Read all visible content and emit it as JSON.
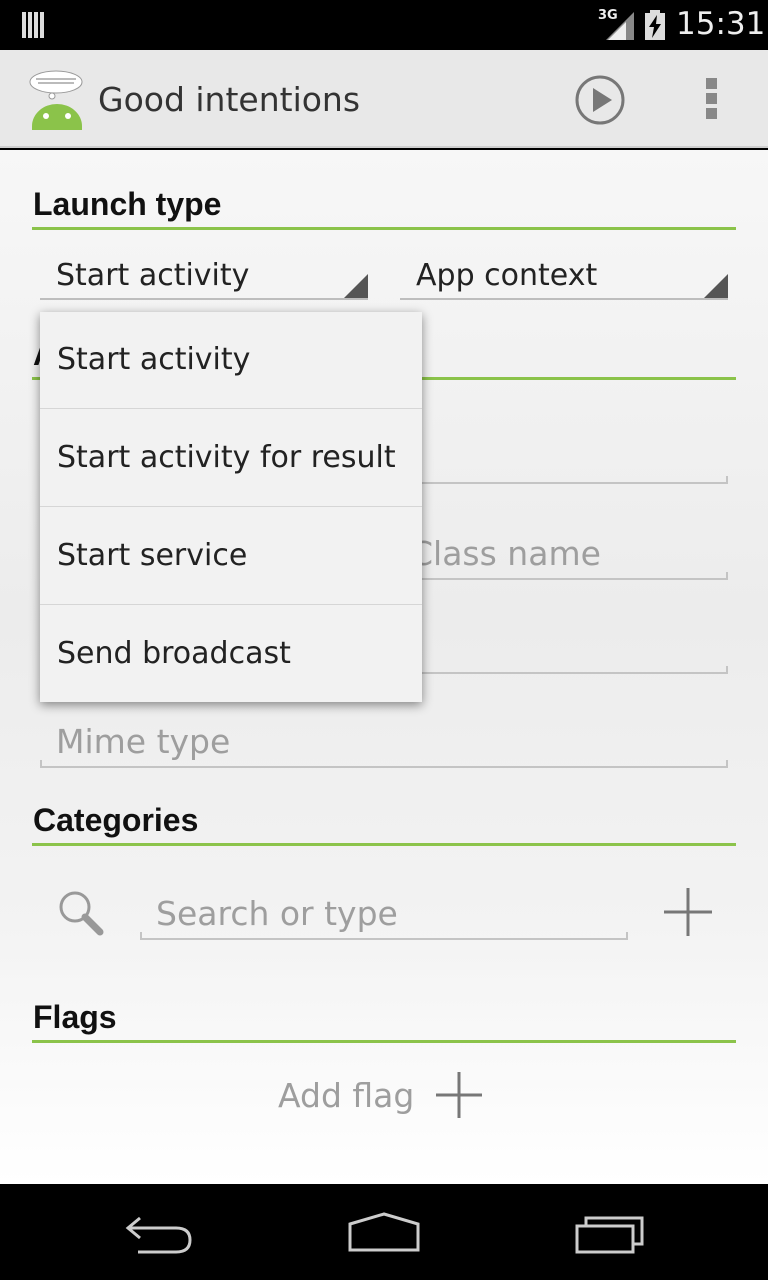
{
  "status_bar": {
    "network": "3G",
    "time": "15:31"
  },
  "app": {
    "title": "Good intentions",
    "icon_caption": "Android robot thinking"
  },
  "toolbar": {
    "run_icon": "play-circle-icon",
    "menu_icon": "overflow-menu-icon"
  },
  "launch_type": {
    "title": "Launch type",
    "spinner_type": "Start activity",
    "spinner_context": "App context"
  },
  "dropdown": {
    "items": [
      {
        "label": "Start activity"
      },
      {
        "label": "Start activity for result"
      },
      {
        "label": "Start service"
      },
      {
        "label": "Send broadcast"
      }
    ]
  },
  "fields": {
    "class_name_placeholder": "Class name",
    "mime_type_placeholder": "Mime type"
  },
  "categories": {
    "title": "Categories",
    "search_placeholder": "Search or type"
  },
  "flags": {
    "title": "Flags",
    "add_label": "Add flag"
  },
  "colors": {
    "accent": "#8bc34a",
    "actionbar": "#e8e8e8"
  }
}
